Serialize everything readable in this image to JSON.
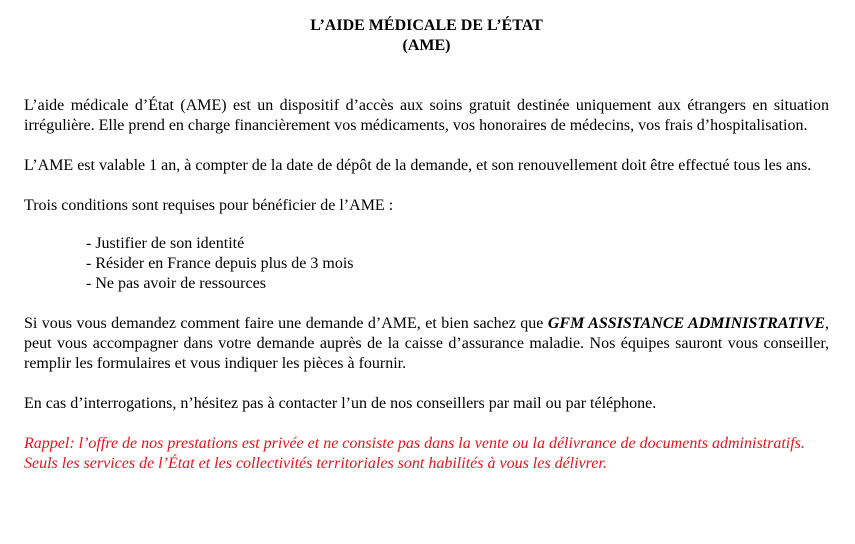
{
  "document": {
    "title_line1": "L’AIDE MÉDICALE DE L’ÉTAT",
    "title_line2": "(AME)",
    "paragraph1": "L’aide médicale d’État (AME) est un dispositif d’accès aux soins gratuit destinée uniquement aux étrangers en situation irrégulière. Elle prend en charge financièrement vos médicaments, vos honoraires de médecins, vos frais d’hospitalisation.",
    "paragraph2": "L’AME est valable 1 an, à compter de la date de dépôt de la demande, et son renouvellement doit être effectué tous les ans.",
    "paragraph3": "Trois conditions sont requises pour bénéficier de l’AME :",
    "conditions": [
      "- Justifier de son identité",
      "- Résider en France depuis plus de 3 mois",
      "- Ne pas avoir de ressources"
    ],
    "paragraph4_before": "Si vous vous demandez comment faire une demande d’AME, et bien sachez que ",
    "paragraph4_company": "GFM ASSISTANCE ADMINISTRATIVE",
    "paragraph4_after": ", peut vous accompagner dans votre demande auprès de la caisse d’assurance maladie. Nos équipes sauront vous conseiller, remplir les formulaires et vous indiquer les pièces à fournir.",
    "paragraph5": "En cas d’interrogations, n’hésitez pas à contacter l’un de nos conseillers par mail ou par téléphone.",
    "reminder": "Rappel: l’offre de nos prestations est privée et ne consiste pas dans la vente ou la délivrance de documents administratifs. Seuls les services de l’État et les collectivités territoriales sont habilités à vous les délivrer."
  },
  "colors": {
    "text": "#000000",
    "reminder": "#e8141b",
    "background": "#ffffff"
  }
}
